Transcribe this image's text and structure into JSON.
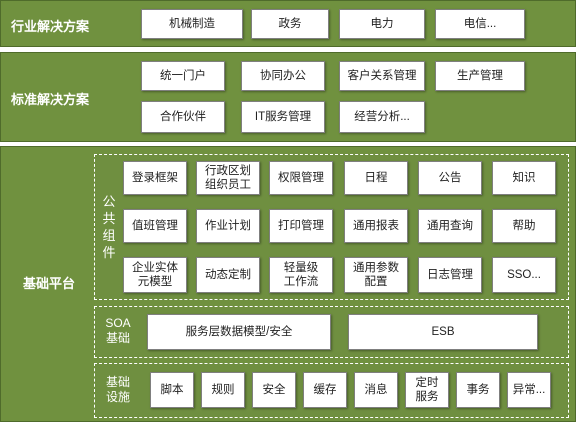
{
  "industry": {
    "title": "行业解决方案",
    "items": [
      "机械制造",
      "政务",
      "电力",
      "电信..."
    ]
  },
  "standard": {
    "title": "标准解决方案",
    "items": [
      "统一门户",
      "协同办公",
      "客户关系管理",
      "生产管理",
      "合作伙伴",
      "IT服务管理",
      "经营分析..."
    ]
  },
  "platform": {
    "title": "基础平台",
    "common": {
      "label": "公共组件",
      "items": [
        "登录框架",
        "行政区划\n组织员工",
        "权限管理",
        "日程",
        "公告",
        "知识",
        "值班管理",
        "作业计划",
        "打印管理",
        "通用报表",
        "通用查询",
        "帮助",
        "企业实体\n元模型",
        "动态定制",
        "轻量级\n工作流",
        "通用参数\n配置",
        "日志管理",
        "SSO..."
      ]
    },
    "soa": {
      "label": "SOA\n基础",
      "items": [
        "服务层数据模型/安全",
        "ESB"
      ]
    },
    "infra": {
      "label": "基础\n设施",
      "items": [
        "脚本",
        "规则",
        "安全",
        "缓存",
        "消息",
        "定时\n服务",
        "事务",
        "异常..."
      ]
    }
  }
}
